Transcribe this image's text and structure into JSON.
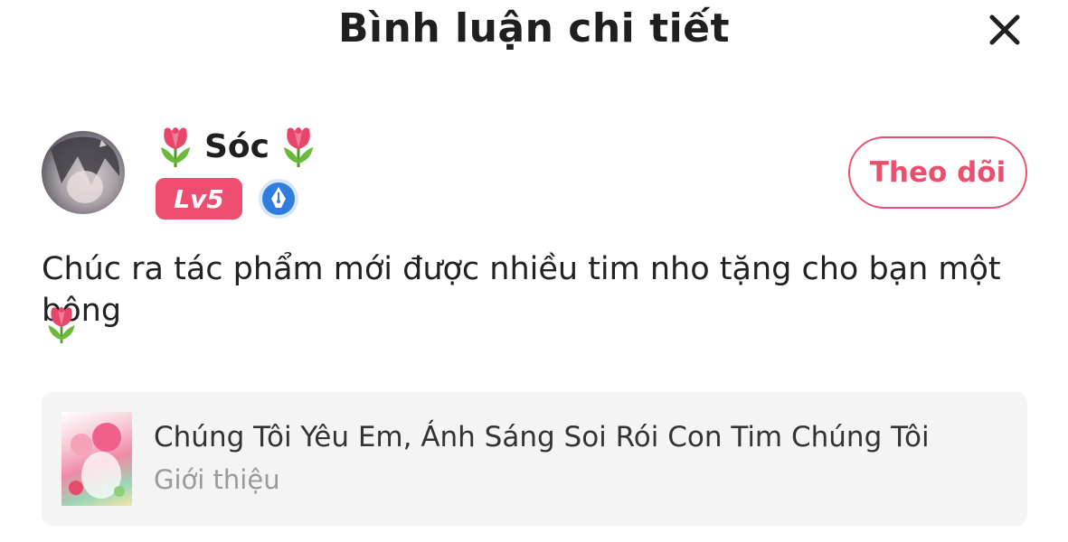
{
  "header": {
    "title": "Bình luận chi tiết"
  },
  "author": {
    "name": "Sóc",
    "level_badge": "Lv5",
    "follow_label": "Theo dõi"
  },
  "comment": {
    "text": "Chúc ra tác phẩm mới được nhiều tim nho tặng cho bạn một bông"
  },
  "work": {
    "title": "Chúng Tôi Yêu Em, Ánh Sáng Soi Rói Con Tim Chúng Tôi",
    "subtitle": "Giới thiệu"
  },
  "colors": {
    "accent": "#e9506f",
    "level_badge_bg": "#ef4d6f",
    "card_bg": "#f4f4f5",
    "verified_badge": "#2f7de1"
  },
  "icons": [
    "close-icon",
    "tulip-icon",
    "pen-nib-badge-icon"
  ]
}
